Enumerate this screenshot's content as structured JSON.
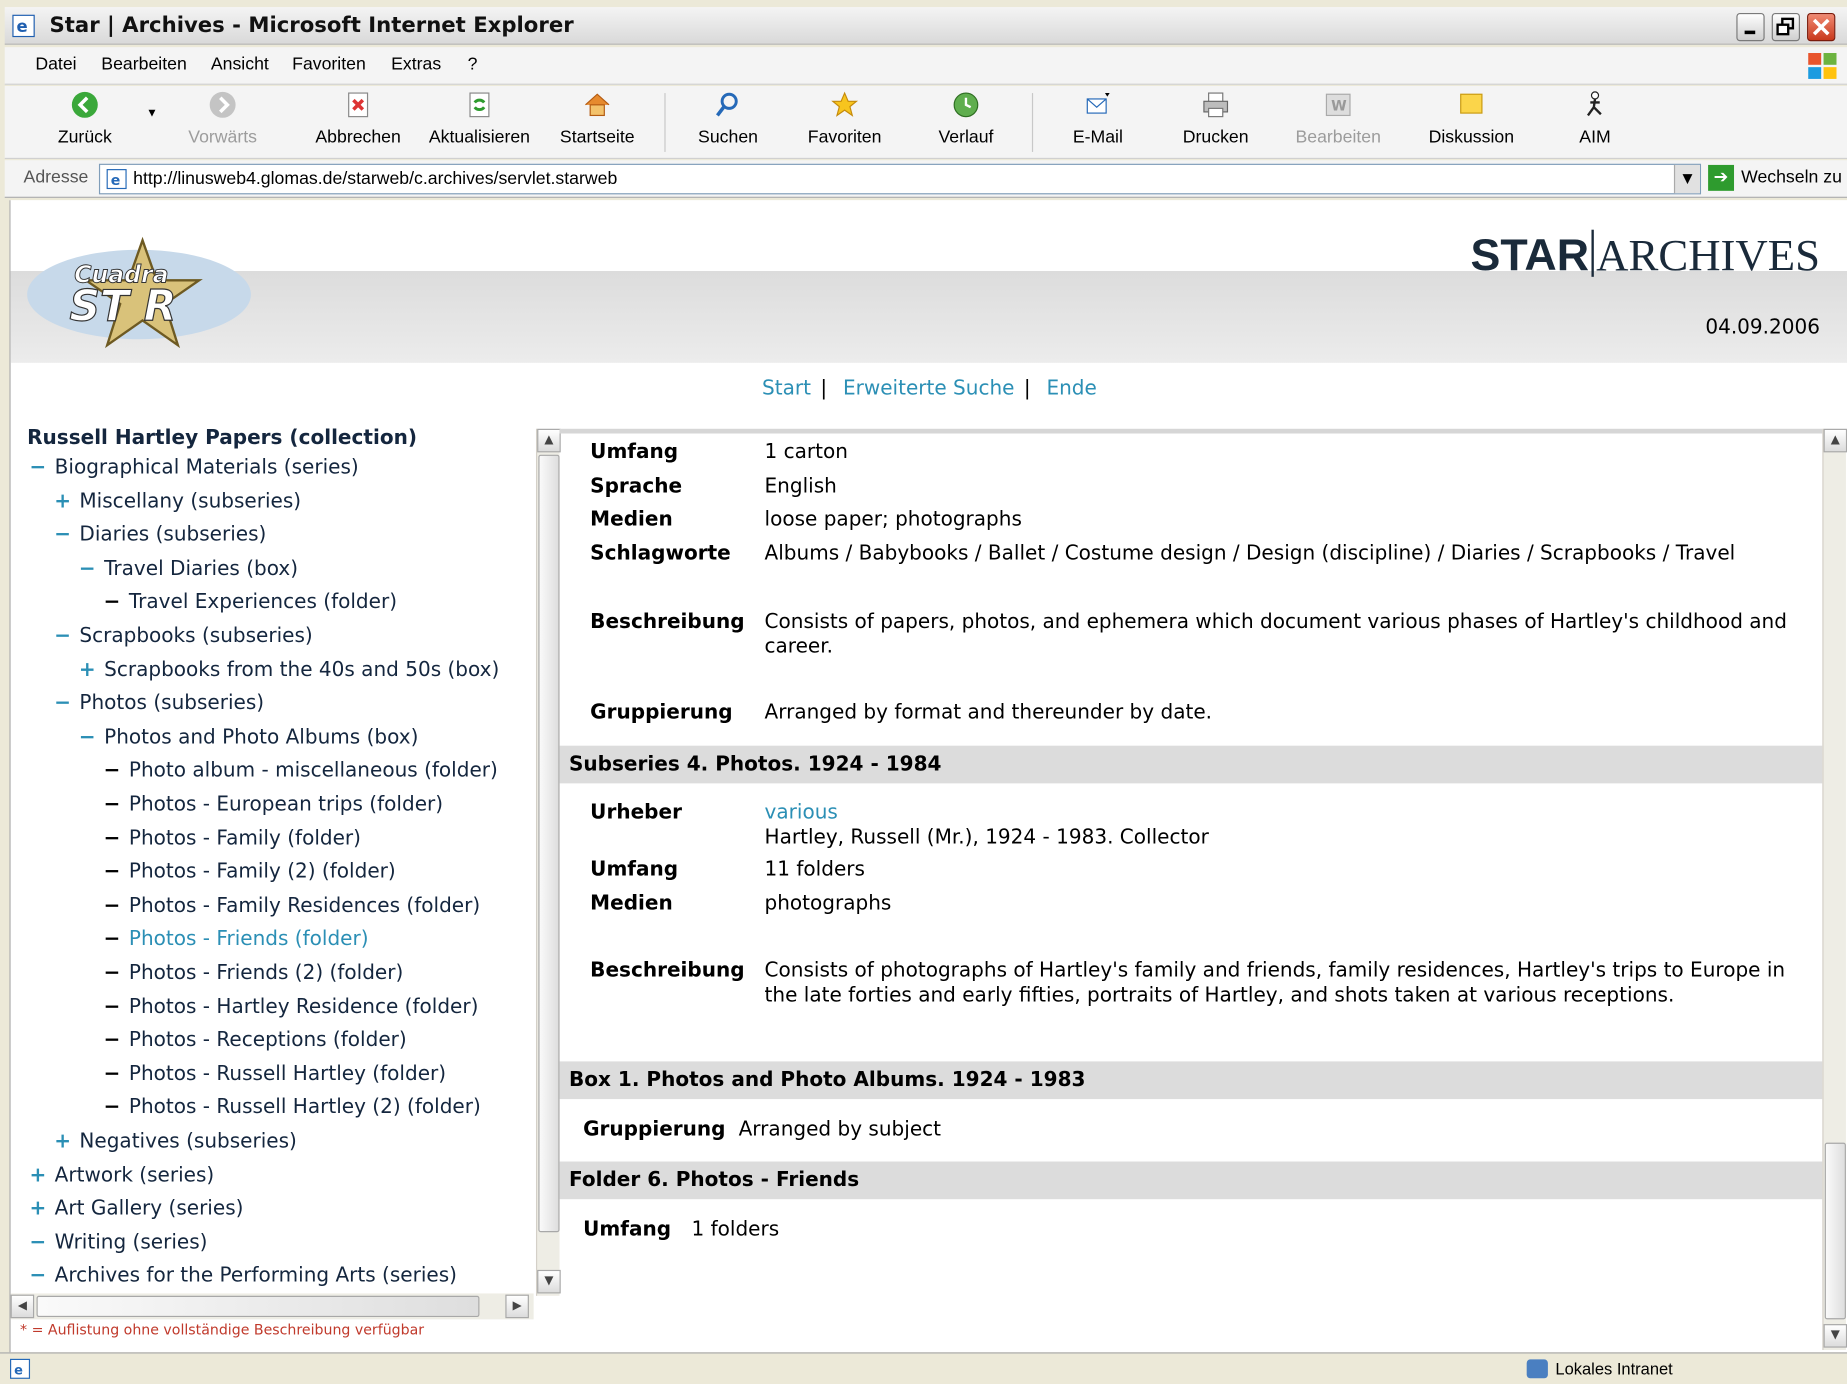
{
  "window": {
    "title": "Star | Archives - Microsoft Internet Explorer"
  },
  "menu": [
    "Datei",
    "Bearbeiten",
    "Ansicht",
    "Favoriten",
    "Extras",
    "?"
  ],
  "toolbar": {
    "back": "Zurück",
    "forward": "Vorwärts",
    "stop": "Abbrechen",
    "refresh": "Aktualisieren",
    "home": "Startseite",
    "search": "Suchen",
    "favorites": "Favoriten",
    "history": "Verlauf",
    "mail": "E-Mail",
    "print": "Drucken",
    "edit": "Bearbeiten",
    "discuss": "Diskussion",
    "aim": "AIM"
  },
  "address": {
    "label": "Adresse",
    "url": "http://linusweb4.glomas.de/starweb/c.archives/servlet.starweb",
    "go": "Wechseln zu"
  },
  "header": {
    "logo_text": "Cuadra STAR",
    "brand_bold": "STAR",
    "brand_rest": "ARCHIVES",
    "date": "04.09.2006"
  },
  "nav": {
    "start": "Start",
    "advanced": "Erweiterte Suche",
    "end": "Ende",
    "separator": "|"
  },
  "tree": {
    "root": "Russell Hartley Papers (collection)",
    "nodes": [
      {
        "sign": "−",
        "label": "Biographical Materials (series)"
      },
      {
        "sign": "+",
        "label": "Miscellany (subseries)"
      },
      {
        "sign": "−",
        "label": "Diaries (subseries)"
      },
      {
        "sign": "−",
        "label": "Travel Diaries (box)"
      },
      {
        "sign": "−",
        "label": "Travel Experiences (folder)"
      },
      {
        "sign": "−",
        "label": "Scrapbooks (subseries)"
      },
      {
        "sign": "+",
        "label": "Scrapbooks from the 40s and 50s (box)"
      },
      {
        "sign": "−",
        "label": "Photos (subseries)"
      },
      {
        "sign": "−",
        "label": "Photos and Photo Albums (box)"
      },
      {
        "sign": "−",
        "label": "Photo album - miscellaneous (folder)"
      },
      {
        "sign": "−",
        "label": "Photos - European trips (folder)"
      },
      {
        "sign": "−",
        "label": "Photos - Family (folder)"
      },
      {
        "sign": "−",
        "label": "Photos - Family (2) (folder)"
      },
      {
        "sign": "−",
        "label": "Photos - Family Residences (folder)"
      },
      {
        "sign": "−",
        "label": "Photos - Friends (folder)"
      },
      {
        "sign": "−",
        "label": "Photos - Friends (2) (folder)"
      },
      {
        "sign": "−",
        "label": "Photos - Hartley Residence (folder)"
      },
      {
        "sign": "−",
        "label": "Photos - Receptions (folder)"
      },
      {
        "sign": "−",
        "label": "Photos - Russell Hartley (folder)"
      },
      {
        "sign": "−",
        "label": "Photos - Russell Hartley (2) (folder)"
      },
      {
        "sign": "+",
        "label": "Negatives (subseries)"
      },
      {
        "sign": "+",
        "label": "Artwork (series)"
      },
      {
        "sign": "+",
        "label": "Art Gallery (series)"
      },
      {
        "sign": "−",
        "label": "Writing (series)"
      },
      {
        "sign": "−",
        "label": "Archives for the Performing Arts (series)"
      }
    ],
    "footnote": "* = Auflistung ohne vollständige Beschreibung verfügbar"
  },
  "detail": {
    "top": {
      "umfang_label": "Umfang",
      "umfang": "1 carton",
      "sprache_label": "Sprache",
      "sprache": "English",
      "medien_label": "Medien",
      "medien": "loose paper; photographs",
      "schlag_label": "Schlagworte",
      "schlag": "Albums / Babybooks / Ballet / Costume design / Design (discipline) / Diaries / Scrapbooks / Travel",
      "beschr_label": "Beschreibung",
      "beschr": "Consists of papers, photos, and ephemera which document various phases of Hartley's childhood and career.",
      "grupp_label": "Gruppierung",
      "grupp": "Arranged by format and thereunder by date."
    },
    "subseries": {
      "heading": "Subseries 4. Photos. 1924 - 1984",
      "urheber_label": "Urheber",
      "urheber_link": "various",
      "urheber_text": "Hartley, Russell (Mr.), 1924 - 1983. Collector",
      "umfang_label": "Umfang",
      "umfang": "11 folders",
      "medien_label": "Medien",
      "medien": "photographs",
      "beschr_label": "Beschreibung",
      "beschr": "Consists of photographs of Hartley's family and friends, family residences, Hartley's trips to Europe in the late forties and early fifties, portraits of Hartley, and shots taken at various receptions."
    },
    "box": {
      "heading": "Box 1. Photos and Photo Albums. 1924 - 1983",
      "grupp_label": "Gruppierung",
      "grupp": "Arranged by subject"
    },
    "folder": {
      "heading": "Folder 6. Photos - Friends",
      "umfang_label": "Umfang",
      "umfang": "1 folders"
    }
  },
  "status": {
    "zone": "Lokales Intranet"
  },
  "colors": {
    "link": "#2b8fb5",
    "section_bar": "#dcdcdc",
    "footnote": "#c0392b"
  }
}
